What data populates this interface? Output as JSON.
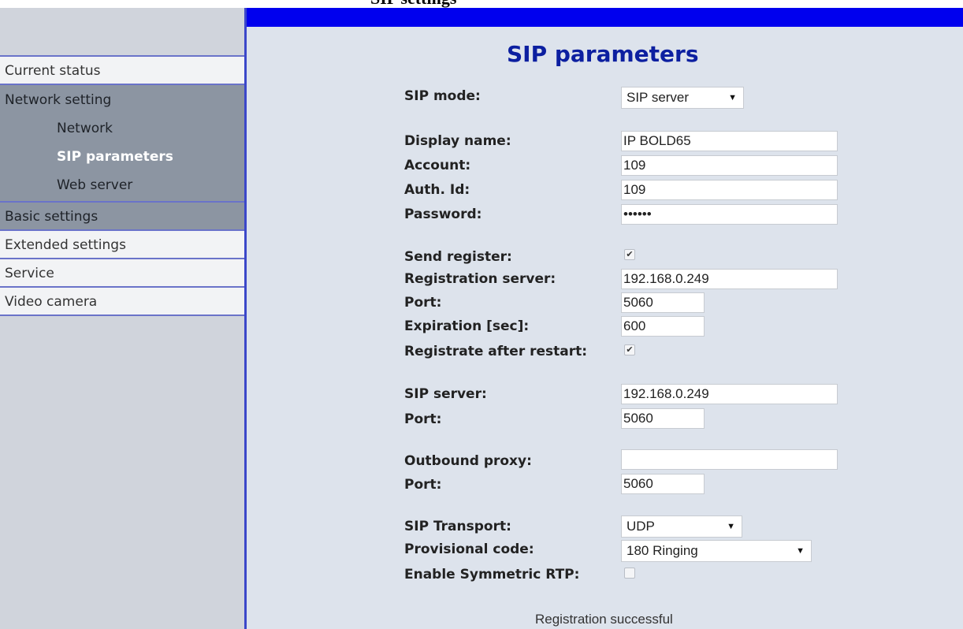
{
  "page_title": "SIP settings",
  "sidebar": {
    "items": [
      {
        "label": "Current status"
      },
      {
        "label": "Network setting",
        "children": [
          {
            "label": "Network"
          },
          {
            "label": "SIP parameters",
            "active": true
          },
          {
            "label": "Web server"
          }
        ]
      },
      {
        "label": "Basic settings"
      },
      {
        "label": "Extended settings"
      },
      {
        "label": "Service"
      },
      {
        "label": "Video camera"
      }
    ]
  },
  "main": {
    "title": "SIP parameters",
    "sip_mode": {
      "label": "SIP mode:",
      "value": "SIP server"
    },
    "display_name": {
      "label": "Display name:",
      "value": "IP BOLD65"
    },
    "account": {
      "label": "Account:",
      "value": "109"
    },
    "auth_id": {
      "label": "Auth. Id:",
      "value": "109"
    },
    "password": {
      "label": "Password:",
      "value": "••••••"
    },
    "send_register": {
      "label": "Send register:",
      "checked": true
    },
    "registration_server": {
      "label": "Registration server:",
      "value": "192.168.0.249"
    },
    "registration_port": {
      "label": "Port:",
      "value": "5060"
    },
    "expiration": {
      "label": "Expiration [sec]:",
      "value": "600"
    },
    "registrate_after_restart": {
      "label": "Registrate after restart:",
      "checked": true
    },
    "sip_server": {
      "label": "SIP server:",
      "value": "192.168.0.249"
    },
    "sip_server_port": {
      "label": "Port:",
      "value": "5060"
    },
    "outbound_proxy": {
      "label": "Outbound proxy:",
      "value": ""
    },
    "outbound_proxy_port": {
      "label": "Port:",
      "value": "5060"
    },
    "sip_transport": {
      "label": "SIP Transport:",
      "value": "UDP"
    },
    "provisional_code": {
      "label": "Provisional code:",
      "value": "180 Ringing"
    },
    "symmetric_rtp": {
      "label": "Enable Symmetric RTP:",
      "checked": false
    },
    "check_mark": "✔",
    "status_text": "Registration successful"
  },
  "colors": {
    "banner_blue": "#0000ee",
    "title_blue": "#0c1fa0",
    "sidebar_bg": "#d0d4dc",
    "sidebar_active_bg": "#8c95a2",
    "content_bg": "#dde3ec"
  }
}
